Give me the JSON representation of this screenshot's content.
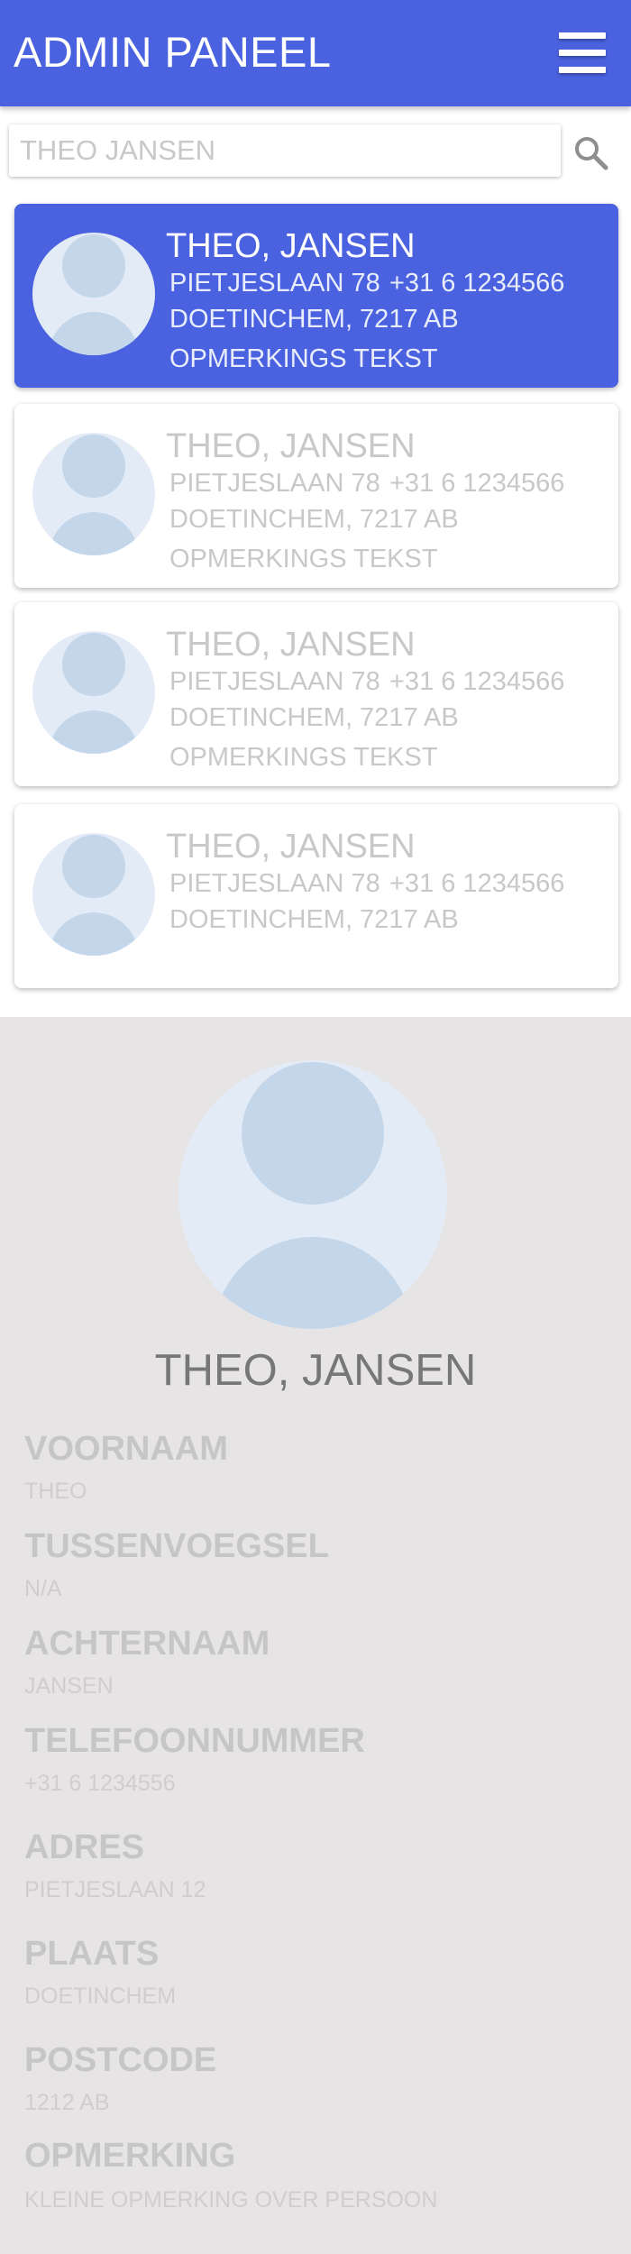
{
  "header": {
    "title": "ADMIN PANEEL"
  },
  "search": {
    "placeholder": "THEO JANSEN"
  },
  "contacts": [
    {
      "name": "THEO, JANSEN",
      "street": "PIETJESLAAN 78",
      "phone": "+31 6 1234566",
      "city": "DOETINCHEM, 7217 AB",
      "note": "OPMERKINGS TEKST",
      "selected": true
    },
    {
      "name": "THEO, JANSEN",
      "street": "PIETJESLAAN 78",
      "phone": "+31 6 1234566",
      "city": "DOETINCHEM, 7217 AB",
      "note": "OPMERKINGS TEKST",
      "selected": false
    },
    {
      "name": "THEO, JANSEN",
      "street": "PIETJESLAAN 78",
      "phone": "+31 6 1234566",
      "city": "DOETINCHEM, 7217 AB",
      "note": "OPMERKINGS TEKST",
      "selected": false
    },
    {
      "name": "THEO, JANSEN",
      "street": "PIETJESLAAN 78",
      "phone": "+31 6 1234566",
      "city": "DOETINCHEM, 7217 AB",
      "note": "",
      "selected": false
    }
  ],
  "detail": {
    "name": "THEO, JANSEN",
    "fields": [
      {
        "label": "VOORNAAM",
        "value": "THEO"
      },
      {
        "label": "TUSSENVOEGSEL",
        "value": "N/A"
      },
      {
        "label": "ACHTERNAAM",
        "value": "JANSEN"
      },
      {
        "label": "TELEFOONNUMMER",
        "value": "+31 6 1234556"
      },
      {
        "label": "ADRES",
        "value": "PIETJESLAAN 12"
      },
      {
        "label": "PLAATS",
        "value": "DOETINCHEM"
      },
      {
        "label": "POSTCODE",
        "value": "1212 AB"
      },
      {
        "label": "OPMERKING",
        "value": "KLEINE OPMERKING OVER PERSOON"
      }
    ]
  },
  "colors": {
    "accent": "#4a62df",
    "detail_bg": "#e6e4e5",
    "muted_text": "#c8c8c8"
  }
}
